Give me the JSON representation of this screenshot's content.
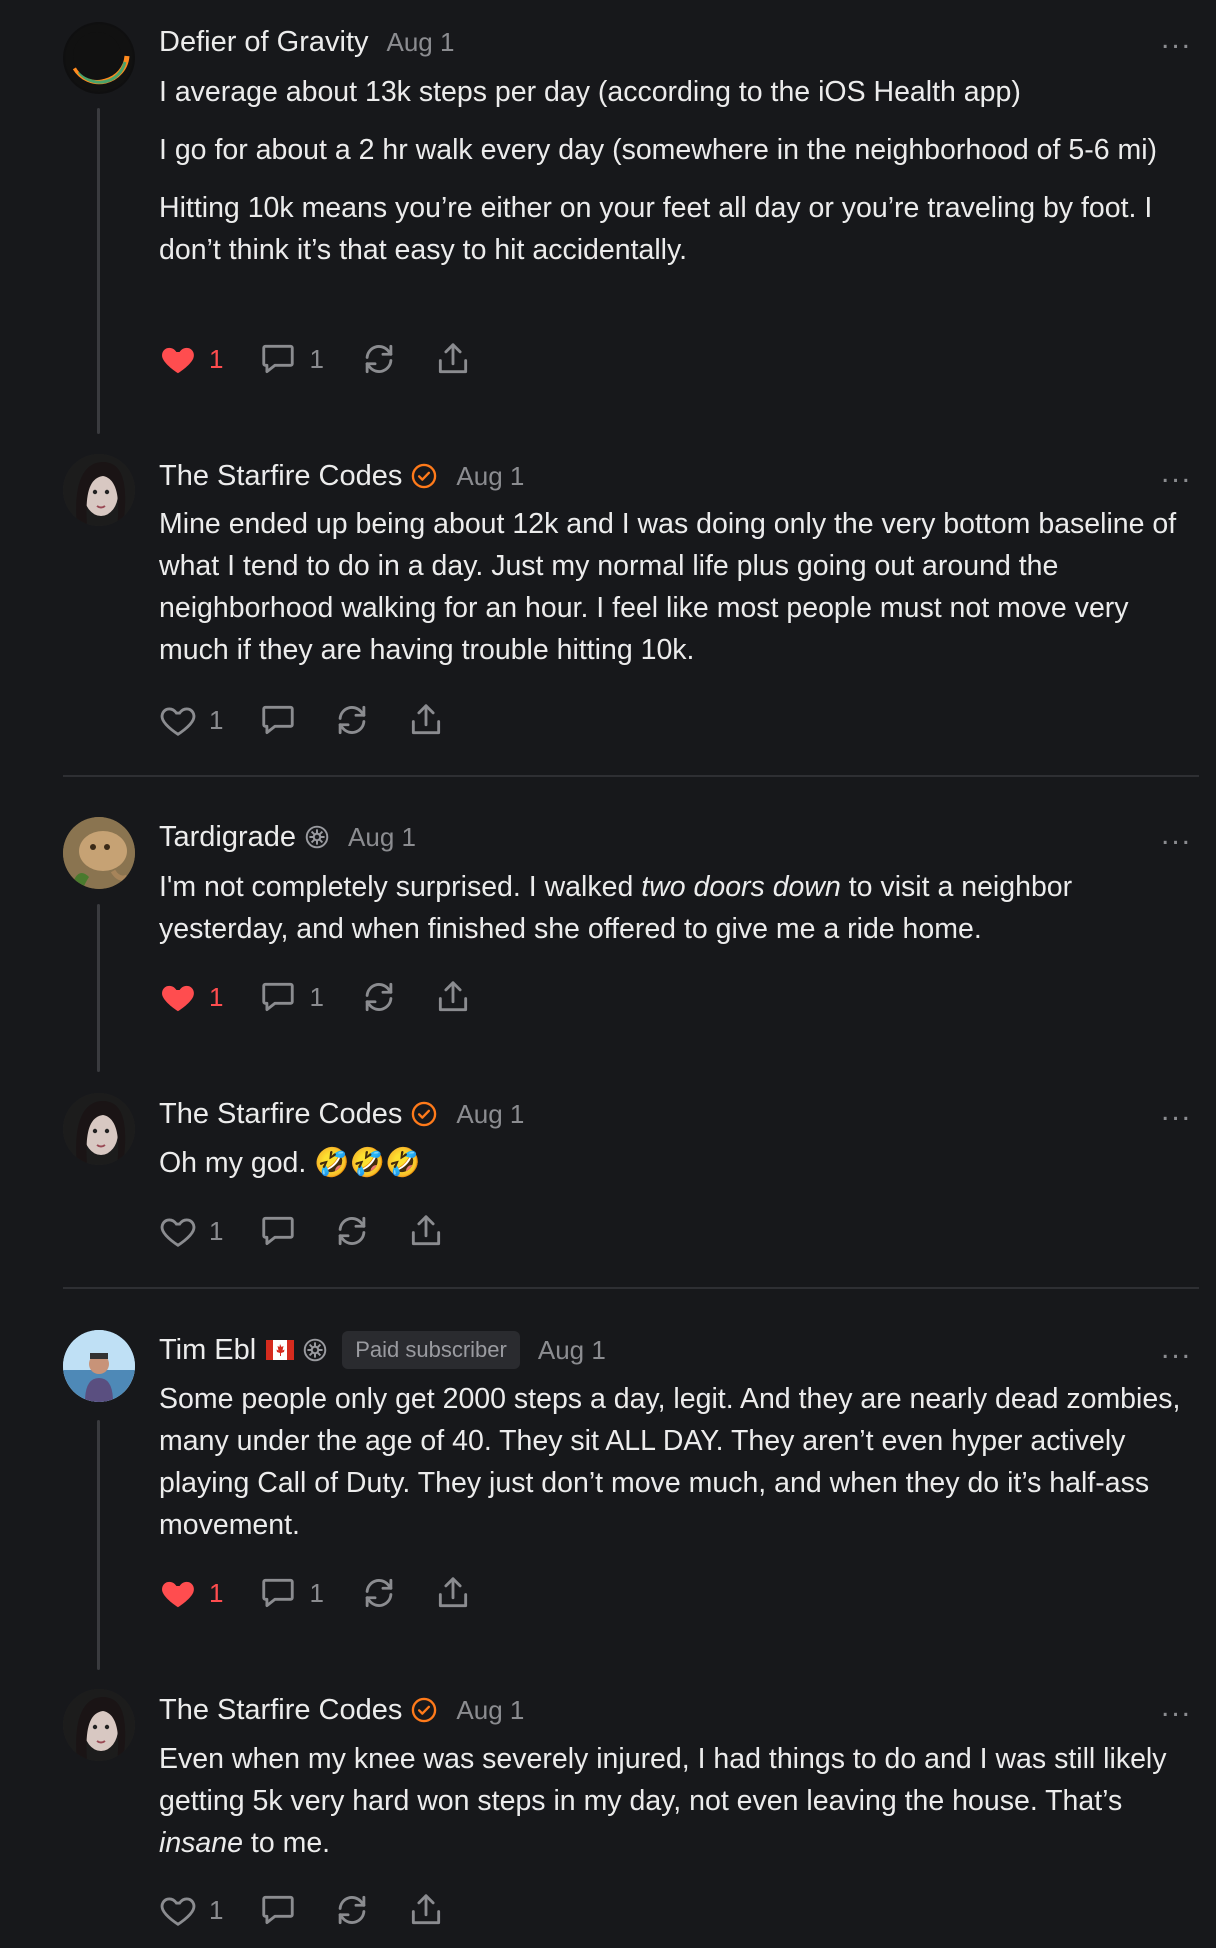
{
  "colors": {
    "background": "#17181b",
    "accent": "#ff7a1a",
    "like": "#ff4d4f",
    "muted": "#8b8c90"
  },
  "comments": [
    {
      "author": "Defier of Gravity",
      "date": "Aug 1",
      "paragraphs": [
        "I average about 13k steps per day (according to the iOS Health app)",
        "I go for about a 2 hr walk every day (somewhere in the neighborhood of 5-6 mi)",
        "Hitting 10k means you’re either on your feet all day or you’re traveling by foot. I don’t think it’s that easy to hit accidentally."
      ],
      "likes": "1",
      "replies": "1",
      "liked": true,
      "more": "..."
    },
    {
      "author": "The Starfire Codes",
      "date": "Aug 1",
      "paragraphs": [
        "Mine ended up being about 12k and I was doing only the very bottom baseline of what I tend to do in a day. Just my normal life plus going out around the neighborhood walking for an hour. I feel like most people must not move very much if they are having trouble hitting 10k."
      ],
      "likes": "1",
      "liked": false,
      "more": "..."
    },
    {
      "author": "Tardigrade",
      "date": "Aug 1",
      "para_a": "I'm not completely surprised. I walked ",
      "para_em": "two doors down",
      "para_b": " to visit a neighbor yesterday, and when finished she offered to give me a ride home.",
      "likes": "1",
      "replies": "1",
      "liked": true,
      "more": "..."
    },
    {
      "author": "The Starfire Codes",
      "date": "Aug 1",
      "text": "Oh my god. 🤣🤣🤣",
      "likes": "1",
      "liked": false,
      "more": "..."
    },
    {
      "author": "Tim Ebl",
      "badge": "Paid subscriber",
      "date": "Aug 1",
      "text": "Some people only get 2000 steps a day, legit. And they are nearly dead zombies, many under the age of 40. They sit ALL DAY. They aren’t even hyper actively playing Call of Duty. They just don’t move much, and when they do it’s half-ass movement.",
      "likes": "1",
      "replies": "1",
      "liked": true,
      "more": "..."
    },
    {
      "author": "The Starfire Codes",
      "date": "Aug 1",
      "para_a": "Even when my knee was severely injured, I had things to do and I was still likely getting 5k very hard won steps in my day, not even leaving the house. That’s ",
      "para_em": "insane",
      "para_b": " to me.",
      "likes": "1",
      "liked": false,
      "more": "..."
    }
  ],
  "icons": {
    "like": "heart-icon",
    "reply": "comment-bubble-icon",
    "restack": "restack-icon",
    "share": "share-icon",
    "verified": "check-badge-icon",
    "subscriber": "gear-badge-icon",
    "flag": "canada-flag-icon"
  }
}
